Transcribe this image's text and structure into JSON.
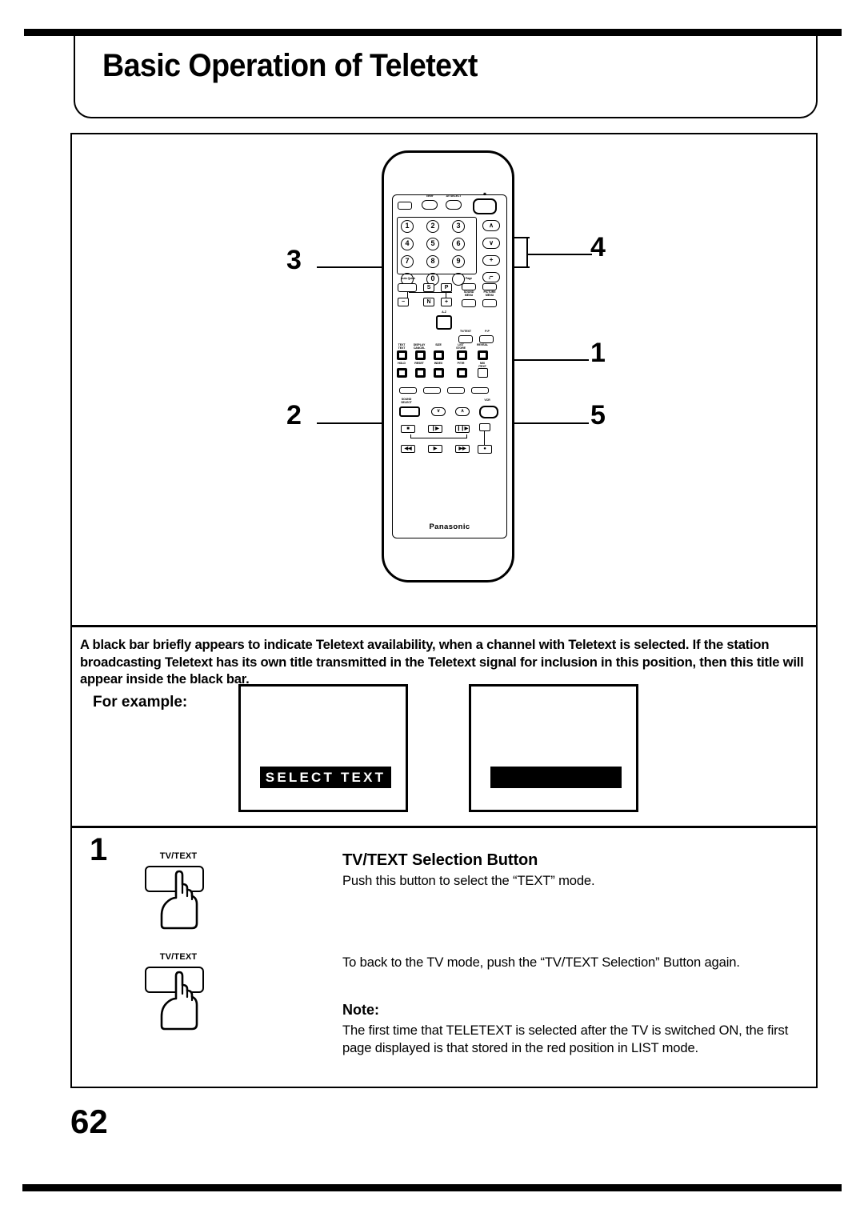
{
  "page": {
    "title": "Basic Operation of Teletext",
    "number": "62"
  },
  "remote": {
    "brand": "Panasonic",
    "top_row": [
      {
        "name": "tv-vcr-button",
        "label": ""
      },
      {
        "name": "timer-button",
        "label": "Timer"
      },
      {
        "name": "av-select-button",
        "label": "AV SELECT"
      },
      {
        "name": "power-button",
        "label": ""
      }
    ],
    "keypad": [
      "1",
      "2",
      "3",
      "4",
      "5",
      "6",
      "7",
      "8",
      "9",
      "0"
    ],
    "side_keys": [
      {
        "name": "channel-up-button",
        "label": "∧"
      },
      {
        "name": "channel-down-button",
        "label": "∨"
      },
      {
        "name": "volume-up-button",
        "label": "+"
      },
      {
        "name": "volume-down-button",
        "label": "−"
      }
    ],
    "mid_keys": [
      {
        "label": "S"
      },
      {
        "label": "P"
      },
      {
        "label": "−"
      },
      {
        "label": "N"
      },
      {
        "label": "+"
      }
    ],
    "mid_labels": [
      "Auto Quick",
      "Page",
      "C",
      "SOUND\nMENU",
      "PICTURE\nMENU"
    ],
    "teletext_labels": [
      "TEXT\nTEXT",
      "DISPLAY\nCANCEL",
      "SIZE",
      "LIST\nSTORE",
      "REVEAL",
      "HOLD",
      "RESET",
      "INDEX",
      "P/T/R",
      "MIX\n/TEXT"
    ],
    "tv_text_label": "TV/TEXT",
    "pp_label": "P-P",
    "vcr_label": "VCR",
    "sound_select_label": "SOUND\nSELECT",
    "callouts": [
      "1",
      "2",
      "3",
      "4",
      "5"
    ]
  },
  "description": {
    "paragraph": "A black bar briefly appears to indicate Teletext availability, when a channel with Teletext is selected. If the station broadcasting Teletext has its own title transmitted in the Teletext signal for inclusion in this position, then this title will appear inside the black bar.",
    "for_example_label": "For example:",
    "screens": [
      {
        "name": "tv-screen-with-title",
        "bar_text": "SELECT  TEXT"
      },
      {
        "name": "tv-screen-blank-bar",
        "bar_text": ""
      }
    ]
  },
  "step": {
    "number": "1",
    "button_caption": "TV/TEXT",
    "heading": "TV/TEXT Selection Button",
    "line1": "Push this button to select the “TEXT” mode.",
    "line2": "To back to the TV mode, push the “TV/TEXT Selection” Button again.",
    "note_heading": "Note:",
    "note_body": "The first time that TELETEXT is selected after the TV is  switched ON, the first page displayed is that stored in the  red position in LIST mode."
  }
}
